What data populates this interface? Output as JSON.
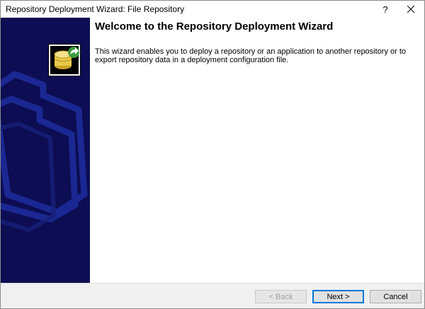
{
  "window": {
    "title": "Repository Deployment Wizard: File Repository",
    "help_label": "?",
    "close_icon": "close-icon"
  },
  "sidebar": {
    "icon": "repository-deploy-icon",
    "background_color": "#0c0d52"
  },
  "content": {
    "heading": "Welcome to the Repository Deployment Wizard",
    "description": "This wizard enables you to deploy a repository or an application to another repository or to export repository data in a deployment configuration file."
  },
  "footer": {
    "back_label": "< Back",
    "next_label": "Next >",
    "cancel_label": "Cancel"
  },
  "colors": {
    "accent": "#0078d7",
    "sidebar": "#0c0d52"
  }
}
